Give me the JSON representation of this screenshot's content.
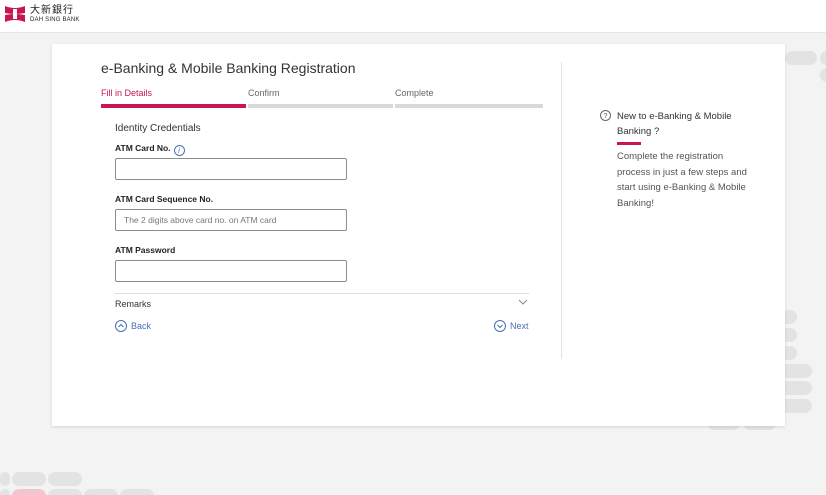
{
  "brand": {
    "name_cn": "大新銀行",
    "name_en": "DAH SING BANK",
    "color": "#c8174f"
  },
  "form": {
    "title": "e-Banking & Mobile Banking Registration",
    "steps": [
      {
        "label": "Fill in Details",
        "active": true
      },
      {
        "label": "Confirm",
        "active": false
      },
      {
        "label": "Complete",
        "active": false
      }
    ],
    "section_title": "Identity Credentials",
    "fields": {
      "card_no": {
        "label": "ATM Card No.",
        "value": "",
        "placeholder": "",
        "info_icon": "info-icon"
      },
      "card_seq": {
        "label": "ATM Card Sequence No.",
        "value": "",
        "placeholder": "The 2 digits above card no. on ATM card"
      },
      "password": {
        "label": "ATM Password",
        "value": "",
        "placeholder": ""
      }
    },
    "remarks_label": "Remarks",
    "back_label": "Back",
    "next_label": "Next"
  },
  "sidebar": {
    "heading": "New to e-Banking & Mobile Banking ?",
    "body": "Complete the registration process in just a few steps and start using e-Banking & Mobile Banking!"
  }
}
